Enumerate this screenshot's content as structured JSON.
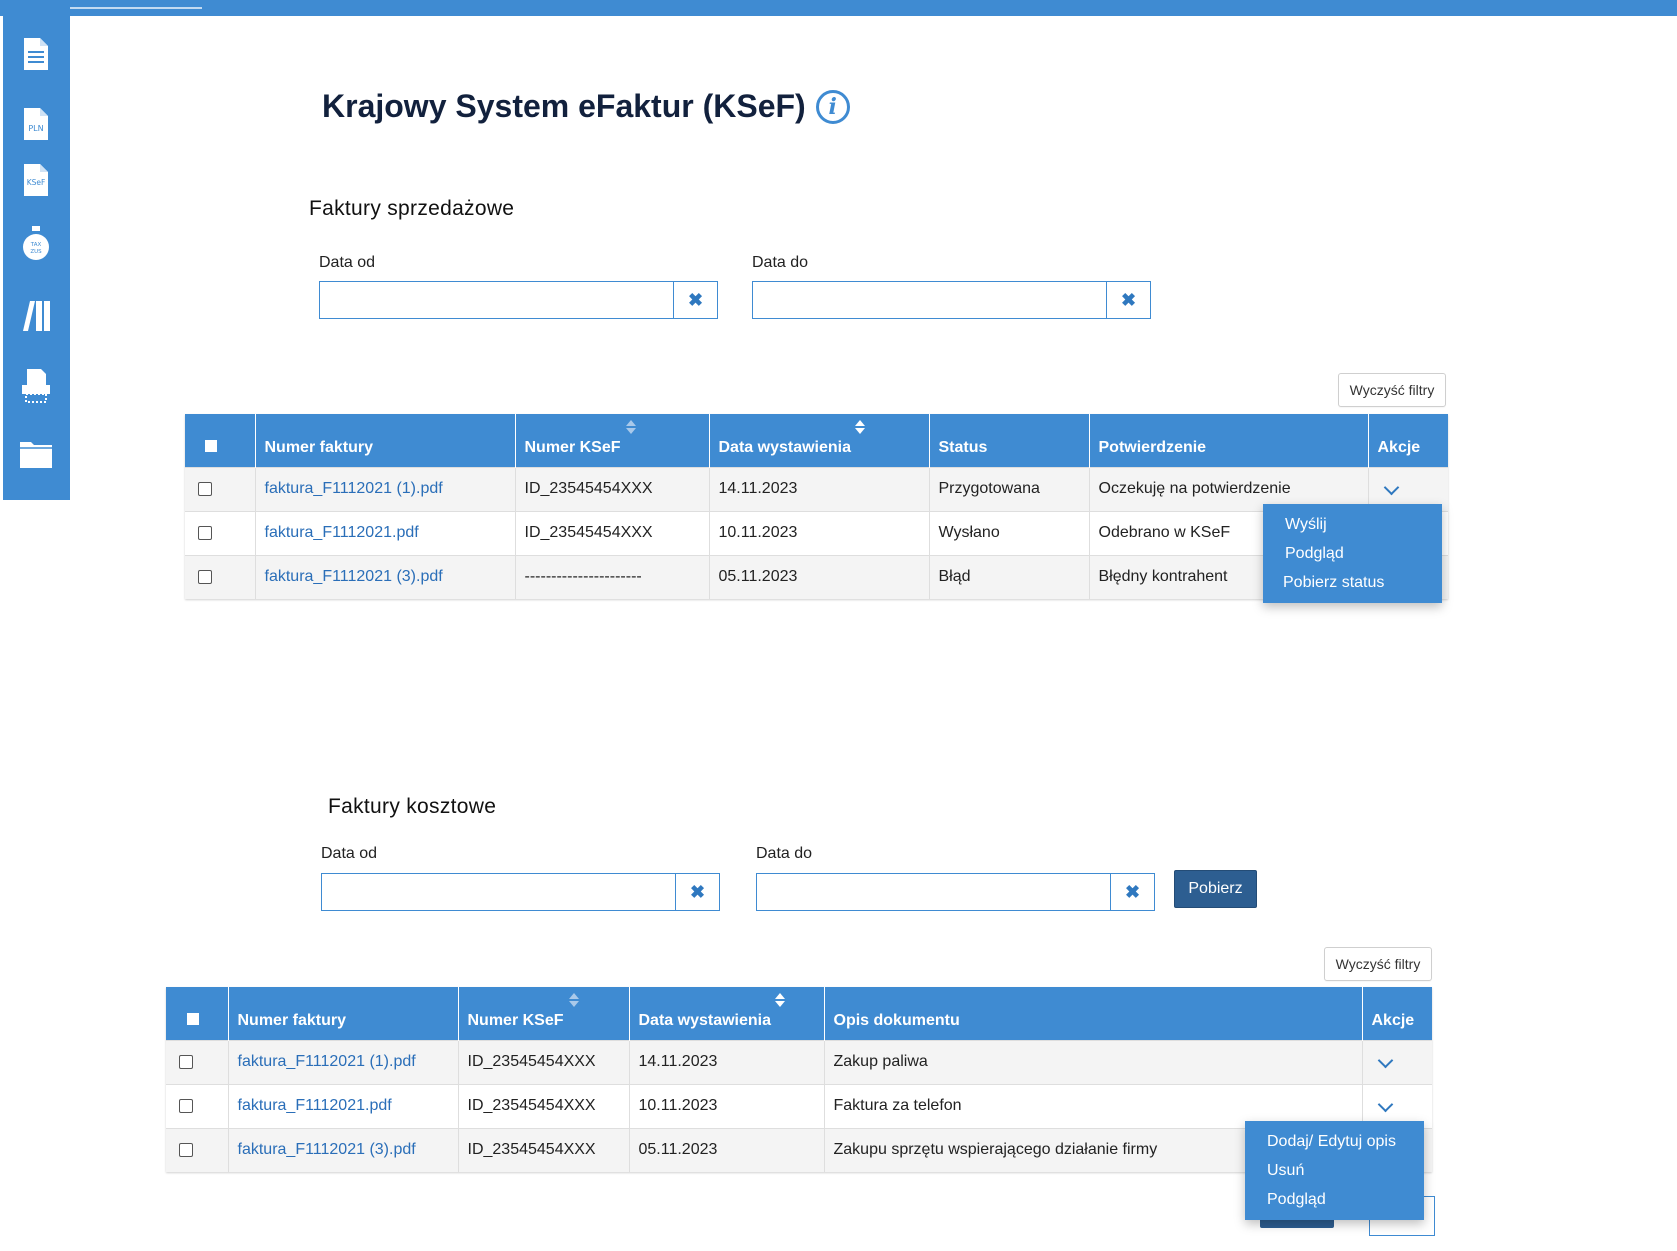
{
  "page": {
    "title": "Krajowy System eFaktur (KSeF)",
    "info_icon": "i"
  },
  "sidebar": {
    "items": [
      {
        "name": "document-icon"
      },
      {
        "name": "pln-document-icon",
        "label": "PLN"
      },
      {
        "name": "ksef-document-icon",
        "label": "KSeF"
      },
      {
        "name": "tax-zus-bag-icon",
        "label": "TAX\nZUS"
      },
      {
        "name": "binders-icon"
      },
      {
        "name": "printer-icon"
      },
      {
        "name": "folder-icon"
      }
    ]
  },
  "sales": {
    "section_title": "Faktury sprzedażowe",
    "date_from_label": "Data od",
    "date_to_label": "Data do",
    "date_from_value": "",
    "date_to_value": "",
    "clear_icon": "✖",
    "clear_filters_label": "Wyczyść filtry",
    "columns": [
      "Numer faktury",
      "Numer KSeF",
      "Data wystawienia",
      "Status",
      "Potwierdzenie",
      "Akcje"
    ],
    "rows": [
      {
        "file": "faktura_F1112021 (1).pdf",
        "ksef": "ID_23545454XXX",
        "date": "14.11.2023",
        "status": "Przygotowana",
        "confirmation": "Oczekuję na potwierdzenie"
      },
      {
        "file": "faktura_F1112021.pdf",
        "ksef": "ID_23545454XXX",
        "date": "10.11.2023",
        "status": "Wysłano",
        "confirmation": "Odebrano w KSeF"
      },
      {
        "file": "faktura_F1112021 (3).pdf",
        "ksef": "----------------------",
        "date": "05.11.2023",
        "status": "Błąd",
        "confirmation": "Błędny kontrahent"
      }
    ],
    "actions_menu": [
      "Wyślij",
      "Podgląd",
      "Pobierz status"
    ]
  },
  "costs": {
    "section_title": "Faktury kosztowe",
    "date_from_label": "Data od",
    "date_to_label": "Data do",
    "date_from_value": "",
    "date_to_value": "",
    "clear_icon": "✖",
    "fetch_label": "Pobierz",
    "clear_filters_label": "Wyczyść filtry",
    "columns": [
      "Numer faktury",
      "Numer KSeF",
      "Data wystawienia",
      "Opis dokumentu",
      "Akcje"
    ],
    "rows": [
      {
        "file": "faktura_F1112021 (1).pdf",
        "ksef": "ID_23545454XXX",
        "date": "14.11.2023",
        "description": "Zakup paliwa"
      },
      {
        "file": "faktura_F1112021.pdf",
        "ksef": "ID_23545454XXX",
        "date": "10.11.2023",
        "description": "Faktura za telefon"
      },
      {
        "file": "faktura_F1112021 (3).pdf",
        "ksef": "ID_23545454XXX",
        "date": "05.11.2023",
        "description": "Zakupu sprzętu wspierającego działanie firmy"
      }
    ],
    "actions_menu": [
      "Dodaj/ Edytuj opis",
      "Usuń",
      "Podgląd"
    ]
  },
  "colors": {
    "accent": "#3f8bd2",
    "primary_button": "#2d5e91",
    "link": "#2a6eb8",
    "title": "#12213d"
  }
}
